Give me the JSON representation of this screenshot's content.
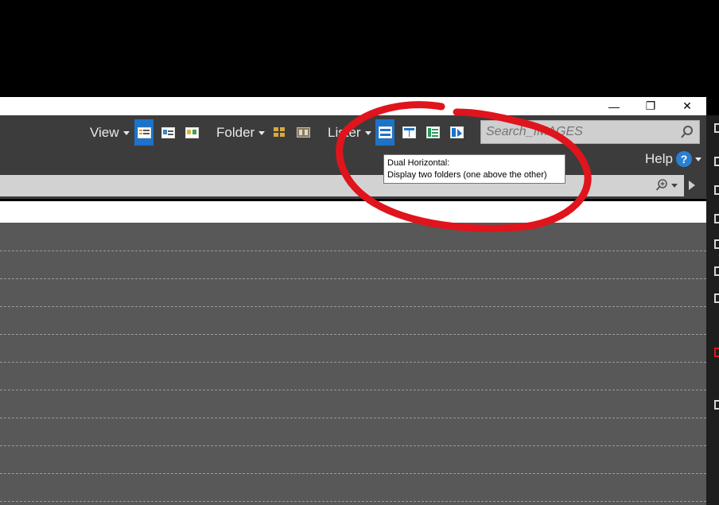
{
  "window": {
    "minimize_glyph": "—",
    "restore_glyph": "❐",
    "close_glyph": "✕"
  },
  "toolbar": {
    "view_label": "View",
    "folder_label": "Folder",
    "lister_label": "Lister",
    "help_label": "Help",
    "help_glyph": "?",
    "search_placeholder": "Search_IMAGES",
    "active_layout": "dual-horizontal"
  },
  "tooltip": {
    "title": "Dual Horizontal:",
    "description": "Display two folders (one above the other)"
  },
  "colors": {
    "accent": "#1e73c8",
    "annotation": "#e0141c",
    "toolbar_bg": "#3c3c3c",
    "content_bg": "#585858"
  },
  "icons": [
    "details-view-icon",
    "power-view-icon",
    "thumbnails-view-icon",
    "folder-tree-icon",
    "folder-split-icon",
    "dual-horizontal-icon",
    "dual-vertical-icon",
    "tree-layout-icon",
    "viewer-layout-icon",
    "search-icon",
    "zoom-icon",
    "help-icon"
  ]
}
